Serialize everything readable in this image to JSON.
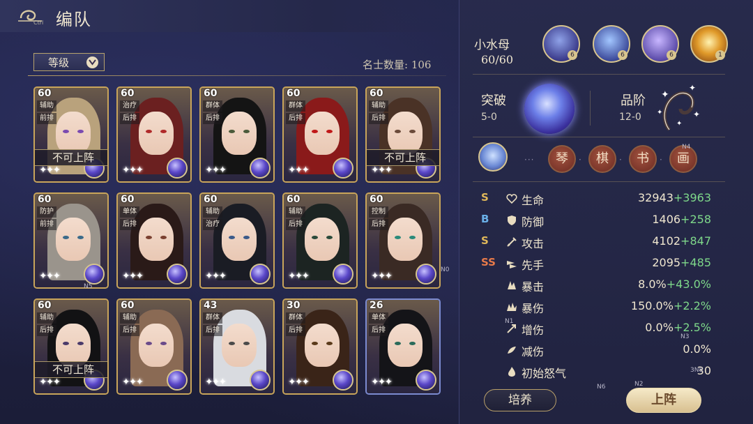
{
  "header": {
    "title": "编队",
    "back_hint": "Ctrl"
  },
  "sort": {
    "label": "等级"
  },
  "roster_count": "名士数量: 106",
  "cards": [
    {
      "level": "60",
      "tags": [
        "辅助",
        "前排"
      ],
      "unavailable": "不可上阵",
      "hair": "#b9a27c",
      "eye": "#7a4ab0",
      "frame": "gold"
    },
    {
      "level": "60",
      "tags": [
        "治疗",
        "后排"
      ],
      "hair": "#6b2020",
      "eye": "#b02a2a",
      "frame": "gold"
    },
    {
      "level": "60",
      "tags": [
        "群体",
        "后排"
      ],
      "hair": "#141414",
      "eye": "#4a5a3a",
      "frame": "gold"
    },
    {
      "level": "60",
      "tags": [
        "群体",
        "后排"
      ],
      "hair": "#8a1a1a",
      "eye": "#c01818",
      "frame": "gold"
    },
    {
      "level": "60",
      "tags": [
        "辅助",
        "后排"
      ],
      "unavailable": "不可上阵",
      "hair": "#4a3226",
      "eye": "#6a4a3a",
      "frame": "gold"
    },
    {
      "level": "60",
      "tags": [
        "防护",
        "前排"
      ],
      "hair": "#9a948c",
      "eye": "#3a6a8a",
      "frame": "gold"
    },
    {
      "level": "60",
      "tags": [
        "单体",
        "后排"
      ],
      "hair": "#2a1a18",
      "eye": "#7a4030",
      "frame": "gold"
    },
    {
      "level": "60",
      "tags": [
        "辅助",
        "治疗"
      ],
      "hair": "#1a1c24",
      "eye": "#3a5a8a",
      "frame": "gold"
    },
    {
      "level": "60",
      "tags": [
        "辅助",
        "后排"
      ],
      "hair": "#1c2422",
      "eye": "#2a4a3a",
      "frame": "gold"
    },
    {
      "level": "60",
      "tags": [
        "控制",
        "后排"
      ],
      "hair": "#3a2a24",
      "eye": "#2a8a7a",
      "frame": "gold"
    },
    {
      "level": "60",
      "tags": [
        "辅助",
        "后排"
      ],
      "unavailable": "不可上阵",
      "hair": "#121214",
      "eye": "#4a3a6a",
      "frame": "gold"
    },
    {
      "level": "60",
      "tags": [
        "辅助",
        "后排"
      ],
      "hair": "#8a6a54",
      "eye": "#6a4a8a",
      "frame": "gold"
    },
    {
      "level": "43",
      "tags": [
        "群体",
        "后排"
      ],
      "hair": "#d9dbe0",
      "eye": "#4a4a4a",
      "frame": "gold"
    },
    {
      "level": "30",
      "tags": [
        "群体",
        "后排"
      ],
      "hair": "#3a2418",
      "eye": "#5a3a1a",
      "frame": "gold"
    },
    {
      "level": "26",
      "tags": [
        "单体",
        "后排"
      ],
      "hair": "#141418",
      "eye": "#2a6a5a",
      "frame": "blue"
    }
  ],
  "hero": {
    "name": "小水母",
    "hp": "60/60",
    "skill_counts": [
      "6",
      "6",
      "6",
      "1"
    ],
    "breakthrough_label": "突破",
    "breakthrough_value": "5-0",
    "grade_label": "品阶",
    "grade_value": "12-0",
    "arts": [
      "琴",
      "棋",
      "书",
      "画"
    ]
  },
  "stats": [
    {
      "grade": "S",
      "grade_color": "#e0b85a",
      "icon": "heart-icon",
      "name": "生命",
      "base": "32943",
      "bonus": "+3963"
    },
    {
      "grade": "B",
      "grade_color": "#6ab0e8",
      "icon": "shield-icon",
      "name": "防御",
      "base": "1406",
      "bonus": "+258"
    },
    {
      "grade": "S",
      "grade_color": "#e0b85a",
      "icon": "sword-icon",
      "name": "攻击",
      "base": "4102",
      "bonus": "+847"
    },
    {
      "grade": "SS",
      "grade_color": "#e87a4a",
      "icon": "speed-icon",
      "name": "先手",
      "base": "2095",
      "bonus": "+485"
    },
    {
      "grade": "",
      "grade_color": "",
      "icon": "crit-icon",
      "name": "暴击",
      "base": "8.0%",
      "bonus": "+43.0%"
    },
    {
      "grade": "",
      "grade_color": "",
      "icon": "crit-damage-icon",
      "name": "暴伤",
      "base": "150.0%",
      "bonus": "+2.2%"
    },
    {
      "grade": "",
      "grade_color": "",
      "icon": "damage-up-icon",
      "name": "增伤",
      "base": "0.0%",
      "bonus": "+2.5%"
    },
    {
      "grade": "",
      "grade_color": "",
      "icon": "damage-reduce-icon",
      "name": "减伤",
      "base": "0.0%",
      "bonus": ""
    },
    {
      "grade": "",
      "grade_color": "",
      "icon": "rage-icon",
      "name": "初始怒气",
      "base": "30",
      "bonus": ""
    }
  ],
  "overlays": {
    "n0": "N0",
    "n1": "N1",
    "n2": "N2",
    "n3": "N3",
    "n4": "N4",
    "n5": "N5",
    "n6": "N6",
    "n8": "3N8"
  },
  "buttons": {
    "train": "培养",
    "deploy": "上阵"
  }
}
